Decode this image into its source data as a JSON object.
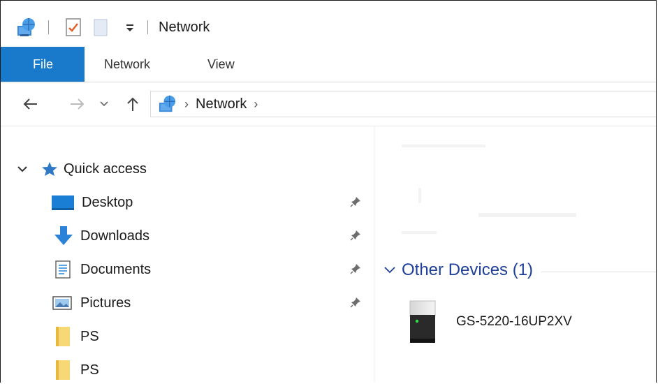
{
  "window": {
    "title": "Network"
  },
  "ribbon": {
    "tabs": [
      "File",
      "Network",
      "View"
    ],
    "active_tab": "File"
  },
  "address": {
    "path": [
      "Network"
    ]
  },
  "nav": {
    "quick_access_label": "Quick access",
    "items": [
      {
        "label": "Desktop",
        "icon": "desktop-icon",
        "pinned": true
      },
      {
        "label": "Downloads",
        "icon": "downloads-icon",
        "pinned": true
      },
      {
        "label": "Documents",
        "icon": "documents-icon",
        "pinned": true
      },
      {
        "label": "Pictures",
        "icon": "pictures-icon",
        "pinned": true
      },
      {
        "label": "PS",
        "icon": "folder-icon",
        "pinned": false
      },
      {
        "label": "PS",
        "icon": "folder-icon",
        "pinned": false
      }
    ]
  },
  "content": {
    "group_title": "Other Devices (1)",
    "devices": [
      {
        "name": "GS-5220-16UP2XV",
        "icon": "network-device-icon"
      }
    ]
  },
  "colors": {
    "accent": "#1979ca",
    "group_header": "#1e3f9a"
  }
}
